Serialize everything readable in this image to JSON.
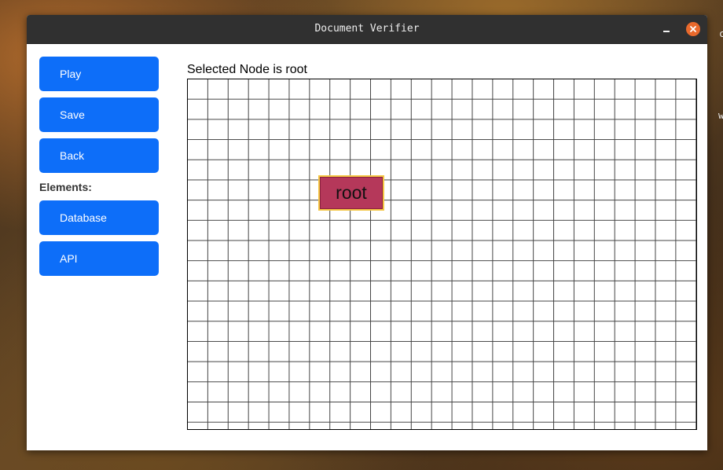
{
  "window": {
    "title": "Document Verifier"
  },
  "desktop": {
    "edge_text_top": "c",
    "edge_text_mid": "w"
  },
  "toolbar": {
    "play_label": "Play",
    "save_label": "Save",
    "back_label": "Back"
  },
  "elements": {
    "heading": "Elements:",
    "items": [
      {
        "label": "Database"
      },
      {
        "label": "API"
      }
    ]
  },
  "canvas": {
    "status": "Selected Node is root",
    "grid_columns": 25,
    "grid_rows": 17,
    "nodes": [
      {
        "label": "root",
        "fill": "#b5385a",
        "border": "#f4c543"
      }
    ]
  },
  "colors": {
    "button": "#0d6ef9",
    "titlebar": "#303030",
    "close": "#e9692c"
  }
}
